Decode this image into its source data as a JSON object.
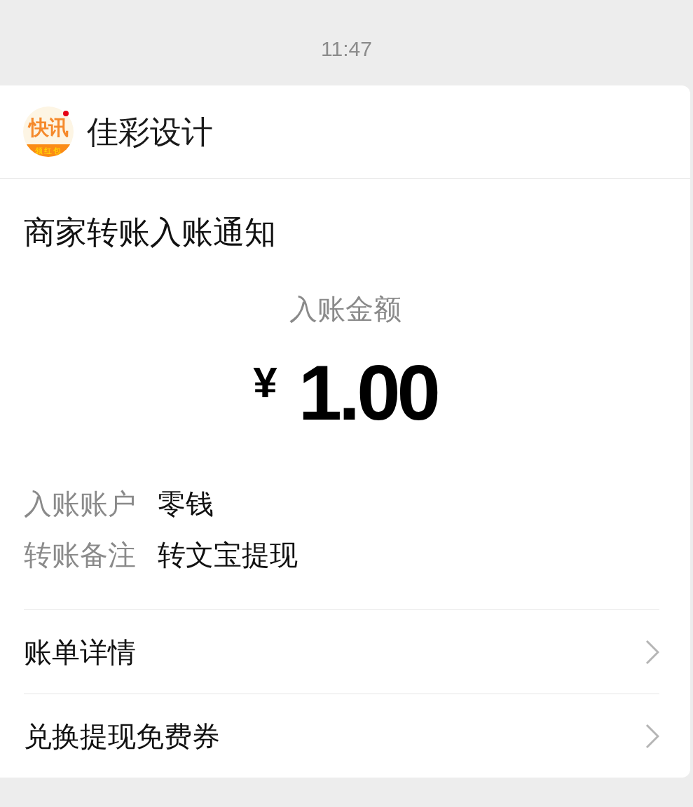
{
  "status": {
    "time": "11:47"
  },
  "header": {
    "logo": {
      "text": "快讯",
      "banner": "领红包"
    },
    "name": "佳彩设计"
  },
  "notice": {
    "title": "商家转账入账通知",
    "amount_label": "入账金额",
    "currency": "¥",
    "amount": "1.00",
    "details": [
      {
        "label": "入账账户",
        "value": "零钱"
      },
      {
        "label": "转账备注",
        "value": "转文宝提现"
      }
    ]
  },
  "links": [
    {
      "label": "账单详情"
    },
    {
      "label": "兑换提现免费券"
    }
  ]
}
